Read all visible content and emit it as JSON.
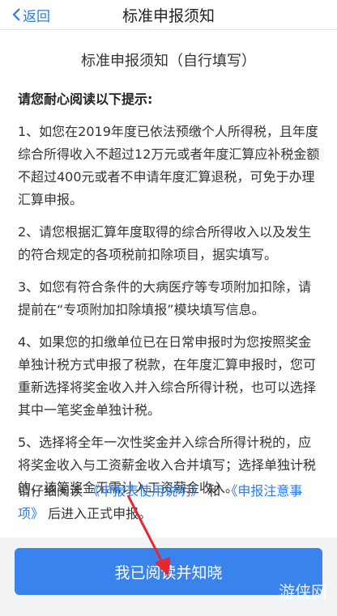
{
  "header": {
    "back_label": "返回",
    "title": "标准申报须知"
  },
  "content": {
    "heading": "标准申报须知（自行填写）",
    "intro": "请您耐心阅读以下提示:",
    "items": [
      "1、如您在2019年度已依法预缴个人所得税，且年度综合所得收入不超过12万元或者年度汇算应补税金额不超过400元或者不申请年度汇算退税，可免于办理汇算申报。",
      "2、请您根据汇算年度取得的综合所得收入以及发生的符合规定的各项税前扣除项目，据实填写。",
      "3、如您有符合条件的大病医疗等专项附加扣除，请提前在“专项附加扣除填报”模块填写信息。",
      "4、如果您的扣缴单位已在日常申报时为您按照奖金单独计税方式申报了税款，在年度汇算申报时，您可重新选择将奖金收入并入综合所得计税，也可以选择其中一笔奖金单独计税。",
      "5、选择将全年一次性奖金并入综合所得计税的，应将奖金收入与工资薪金收入合并填写；选择单独计税的，该笔奖金无需计入工资薪金收入。"
    ],
    "footer": {
      "prefix": "请仔细阅读",
      "link1": "《申报表使用说明》",
      "middle": "和",
      "link2": "《申报注意事项》",
      "suffix": "后进入正式申报。"
    }
  },
  "button": {
    "label": "我已阅读并知晓"
  },
  "watermark": "游侠网",
  "colors": {
    "accent": "#2b7be5",
    "button": "#3a82ec",
    "annotation_arrow": "#e8262d"
  }
}
